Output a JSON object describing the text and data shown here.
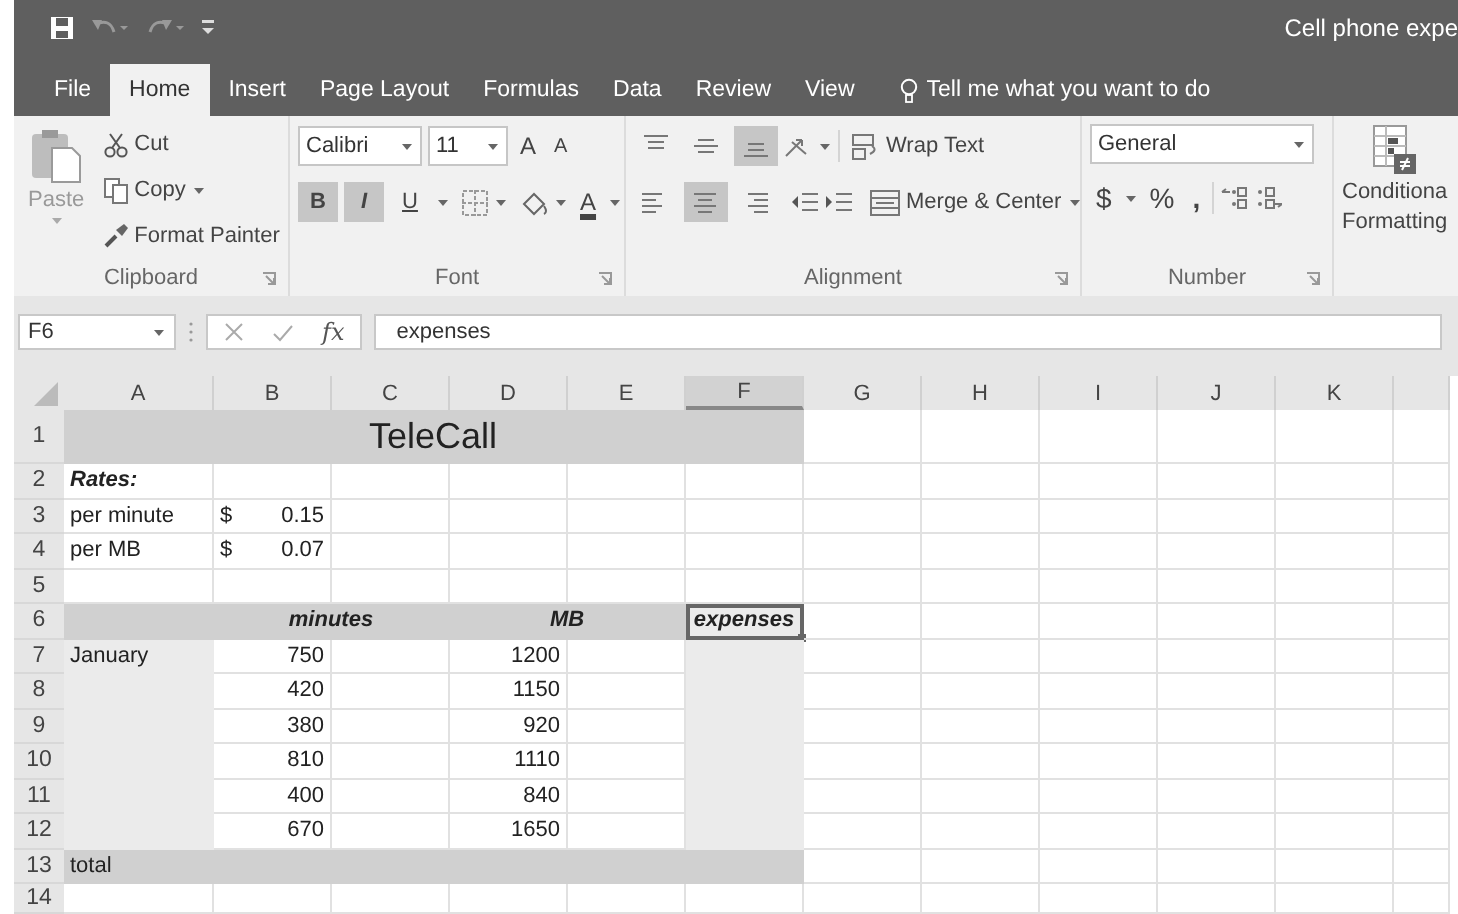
{
  "window": {
    "title": "Cell phone expe"
  },
  "tabs": [
    {
      "label": "File",
      "selected": false
    },
    {
      "label": "Home",
      "selected": true
    },
    {
      "label": "Insert",
      "selected": false
    },
    {
      "label": "Page Layout",
      "selected": false
    },
    {
      "label": "Formulas",
      "selected": false
    },
    {
      "label": "Data",
      "selected": false
    },
    {
      "label": "Review",
      "selected": false
    },
    {
      "label": "View",
      "selected": false
    }
  ],
  "tell_me": {
    "placeholder": "Tell me what you want to do"
  },
  "clipboard": {
    "paste": "Paste",
    "cut": "Cut",
    "copy": "Copy",
    "format_painter": "Format Painter",
    "label": "Clipboard"
  },
  "font": {
    "name": "Calibri",
    "size": "11",
    "grow": "A",
    "shrink": "A",
    "font_color": "A",
    "label": "Font",
    "buttons": [
      {
        "kind": "bold",
        "label": "B",
        "selected": true
      },
      {
        "kind": "italic",
        "label": "I",
        "selected": true
      },
      {
        "kind": "underline",
        "label": "U",
        "selected": false
      }
    ]
  },
  "alignment": {
    "wrap_text": "Wrap Text",
    "merge": "Merge & Center",
    "label": "Alignment",
    "vertical": [
      {
        "kind": "top",
        "selected": false
      },
      {
        "kind": "middle",
        "selected": false
      },
      {
        "kind": "bottom",
        "selected": true
      }
    ],
    "horizontal": [
      {
        "kind": "left",
        "selected": false
      },
      {
        "kind": "center",
        "selected": true
      },
      {
        "kind": "right",
        "selected": false
      }
    ]
  },
  "number": {
    "format": "General",
    "currency": "$",
    "percent": "%",
    "comma": ",",
    "label": "Number"
  },
  "styles": {
    "conditional_formatting": [
      "Conditiona",
      "Formatting"
    ]
  },
  "formula_bar": {
    "name_box": "F6",
    "fx": "fx",
    "value": "expenses"
  },
  "sheet": {
    "columns": [
      {
        "label": "A",
        "selected": false
      },
      {
        "label": "B",
        "selected": false
      },
      {
        "label": "C",
        "selected": false
      },
      {
        "label": "D",
        "selected": false
      },
      {
        "label": "E",
        "selected": false
      },
      {
        "label": "F",
        "selected": true
      },
      {
        "label": "G",
        "selected": false
      },
      {
        "label": "H",
        "selected": false
      },
      {
        "label": "I",
        "selected": false
      },
      {
        "label": "J",
        "selected": false
      },
      {
        "label": "K",
        "selected": false
      }
    ],
    "rows": [
      {
        "label": "1",
        "cells": [
          {
            "kind": "title",
            "text": "TeleCall",
            "color": "#d0d0d0",
            "selected": false
          },
          {
            "kind": "merged"
          },
          {
            "kind": "merged"
          },
          {
            "kind": "merged"
          },
          {
            "kind": "merged"
          },
          {
            "kind": "merged"
          }
        ]
      },
      {
        "label": "2",
        "cells": [
          {
            "kind": "text",
            "text": "Rates:",
            "bold": true,
            "italic": true,
            "selected": false
          }
        ]
      },
      {
        "label": "3",
        "cells": [
          {
            "kind": "text",
            "text": "per minute",
            "selected": false
          },
          {
            "kind": "currency",
            "symbol": "$",
            "text": "0.15",
            "selected": false
          }
        ]
      },
      {
        "label": "4",
        "cells": [
          {
            "kind": "text",
            "text": "per MB",
            "selected": false
          },
          {
            "kind": "currency",
            "symbol": "$",
            "text": "0.07",
            "selected": false
          }
        ]
      },
      {
        "label": "5"
      },
      {
        "label": "6",
        "cells": [
          {
            "kind": "empty",
            "color": "#d0d0d0",
            "selected": false
          },
          {
            "kind": "header",
            "text": "minutes",
            "bold": true,
            "italic": true,
            "color": "#d0d0d0",
            "selected": false
          },
          {
            "kind": "merged"
          },
          {
            "kind": "header",
            "text": "MB",
            "bold": true,
            "italic": true,
            "color": "#d0d0d0",
            "selected": false
          },
          {
            "kind": "merged"
          },
          {
            "kind": "header",
            "text": "expenses",
            "bold": true,
            "italic": true,
            "color": "#ebebeb",
            "selected": true
          }
        ]
      },
      {
        "label": "7",
        "cells": [
          {
            "kind": "text",
            "text": "January",
            "color": "#ebebeb",
            "selected": false
          },
          {
            "kind": "number",
            "text": "750",
            "selected": false
          },
          {
            "kind": "empty",
            "selected": false
          },
          {
            "kind": "number",
            "text": "1200",
            "selected": false
          },
          {
            "kind": "empty",
            "selected": false
          },
          {
            "kind": "empty",
            "color": "#ebebeb",
            "selected": false
          }
        ]
      },
      {
        "label": "8",
        "cells": [
          {
            "kind": "empty",
            "color": "#ebebeb",
            "selected": false
          },
          {
            "kind": "number",
            "text": "420",
            "selected": false
          },
          {
            "kind": "empty",
            "selected": false
          },
          {
            "kind": "number",
            "text": "1150",
            "selected": false
          },
          {
            "kind": "empty",
            "selected": false
          },
          {
            "kind": "empty",
            "color": "#ebebeb",
            "selected": false
          }
        ]
      },
      {
        "label": "9",
        "cells": [
          {
            "kind": "empty",
            "color": "#ebebeb",
            "selected": false
          },
          {
            "kind": "number",
            "text": "380",
            "selected": false
          },
          {
            "kind": "empty",
            "selected": false
          },
          {
            "kind": "number",
            "text": "920",
            "selected": false
          },
          {
            "kind": "empty",
            "selected": false
          },
          {
            "kind": "empty",
            "color": "#ebebeb",
            "selected": false
          }
        ]
      },
      {
        "label": "10",
        "cells": [
          {
            "kind": "empty",
            "color": "#ebebeb",
            "selected": false
          },
          {
            "kind": "number",
            "text": "810",
            "selected": false
          },
          {
            "kind": "empty",
            "selected": false
          },
          {
            "kind": "number",
            "text": "1110",
            "selected": false
          },
          {
            "kind": "empty",
            "selected": false
          },
          {
            "kind": "empty",
            "color": "#ebebeb",
            "selected": false
          }
        ]
      },
      {
        "label": "11",
        "cells": [
          {
            "kind": "empty",
            "color": "#ebebeb",
            "selected": false
          },
          {
            "kind": "number",
            "text": "400",
            "selected": false
          },
          {
            "kind": "empty",
            "selected": false
          },
          {
            "kind": "number",
            "text": "840",
            "selected": false
          },
          {
            "kind": "empty",
            "selected": false
          },
          {
            "kind": "empty",
            "color": "#ebebeb",
            "selected": false
          }
        ]
      },
      {
        "label": "12",
        "cells": [
          {
            "kind": "empty",
            "color": "#ebebeb",
            "selected": false
          },
          {
            "kind": "number",
            "text": "670",
            "selected": false
          },
          {
            "kind": "empty",
            "selected": false
          },
          {
            "kind": "number",
            "text": "1650",
            "selected": false
          },
          {
            "kind": "empty",
            "selected": false
          },
          {
            "kind": "empty",
            "color": "#ebebeb",
            "selected": false
          }
        ]
      },
      {
        "label": "13",
        "cells": [
          {
            "kind": "text",
            "text": "total",
            "color": "#d0d0d0",
            "selected": false
          },
          {
            "kind": "merged"
          },
          {
            "kind": "merged"
          },
          {
            "kind": "merged"
          },
          {
            "kind": "merged"
          },
          {
            "kind": "merged"
          }
        ]
      },
      {
        "label": "14"
      }
    ]
  }
}
